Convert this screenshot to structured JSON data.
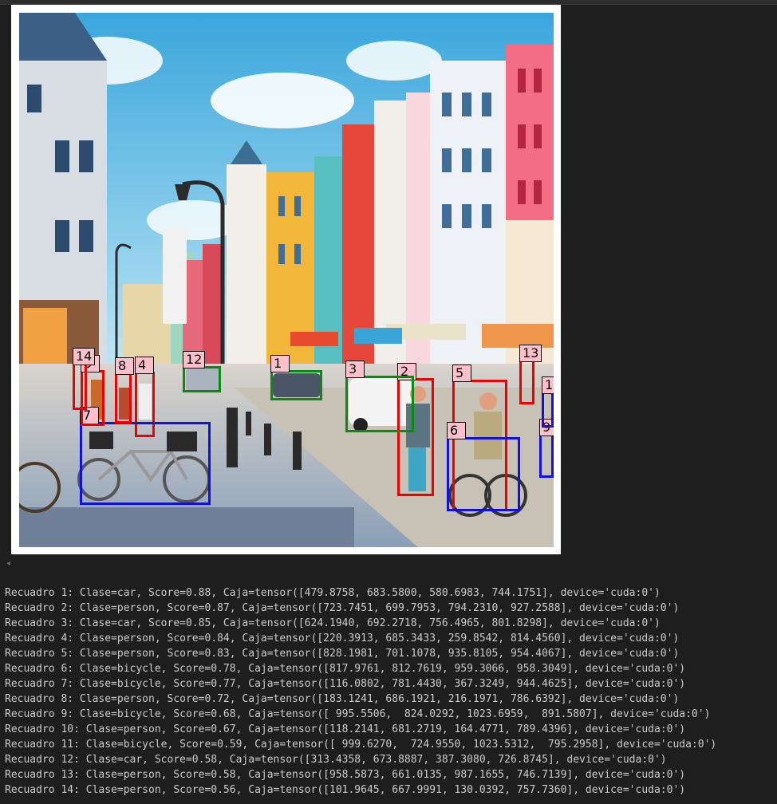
{
  "colors": {
    "background": "#1e1e1e",
    "text": "#cccccc",
    "person_box": "#e00000",
    "car_box": "#0a8a10",
    "bicycle_box": "#1010e0",
    "label_bg": "#ffc0cb"
  },
  "image": {
    "description_icon": "street-scene-image",
    "labels": [
      {
        "id": "1",
        "class": "car"
      },
      {
        "id": "2",
        "class": "person"
      },
      {
        "id": "3",
        "class": "car"
      },
      {
        "id": "4",
        "class": "person"
      },
      {
        "id": "5",
        "class": "person"
      },
      {
        "id": "6",
        "class": "bicycle"
      },
      {
        "id": "7",
        "class": "bicycle"
      },
      {
        "id": "8",
        "class": "person"
      },
      {
        "id": "9",
        "class": "bicycle"
      },
      {
        "id": "0",
        "class": "person"
      },
      {
        "id": "1",
        "class": "bicycle"
      },
      {
        "id": "12",
        "class": "car"
      },
      {
        "id": "13",
        "class": "person"
      },
      {
        "id": "14",
        "class": "person"
      }
    ]
  },
  "output_lines": [
    "Recuadro 1: Clase=car, Score=0.88, Caja=tensor([479.8758, 683.5800, 580.6983, 744.1751], device='cuda:0')",
    "Recuadro 2: Clase=person, Score=0.87, Caja=tensor([723.7451, 699.7953, 794.2310, 927.2588], device='cuda:0')",
    "Recuadro 3: Clase=car, Score=0.85, Caja=tensor([624.1940, 692.2718, 756.4965, 801.8298], device='cuda:0')",
    "Recuadro 4: Clase=person, Score=0.84, Caja=tensor([220.3913, 685.3433, 259.8542, 814.4560], device='cuda:0')",
    "Recuadro 5: Clase=person, Score=0.83, Caja=tensor([828.1981, 701.1078, 935.8105, 954.4067], device='cuda:0')",
    "Recuadro 6: Clase=bicycle, Score=0.78, Caja=tensor([817.9761, 812.7619, 959.3066, 958.3049], device='cuda:0')",
    "Recuadro 7: Clase=bicycle, Score=0.77, Caja=tensor([116.0802, 781.4430, 367.3249, 944.4625], device='cuda:0')",
    "Recuadro 8: Clase=person, Score=0.72, Caja=tensor([183.1241, 686.1921, 216.1971, 786.6392], device='cuda:0')",
    "Recuadro 9: Clase=bicycle, Score=0.68, Caja=tensor([ 995.5506,  824.0292, 1023.6959,  891.5807], device='cuda:0')",
    "Recuadro 10: Clase=person, Score=0.67, Caja=tensor([118.2141, 681.2719, 164.4771, 789.4396], device='cuda:0')",
    "Recuadro 11: Clase=bicycle, Score=0.59, Caja=tensor([ 999.6270,  724.9550, 1023.5312,  795.2958], device='cuda:0')",
    "Recuadro 12: Clase=car, Score=0.58, Caja=tensor([313.4358, 673.8887, 387.3080, 726.8745], device='cuda:0')",
    "Recuadro 13: Clase=person, Score=0.58, Caja=tensor([958.5873, 661.0135, 987.1655, 746.7139], device='cuda:0')",
    "Recuadro 14: Clase=person, Score=0.56, Caja=tensor([101.9645, 667.9991, 130.0392, 757.7360], device='cuda:0')"
  ]
}
